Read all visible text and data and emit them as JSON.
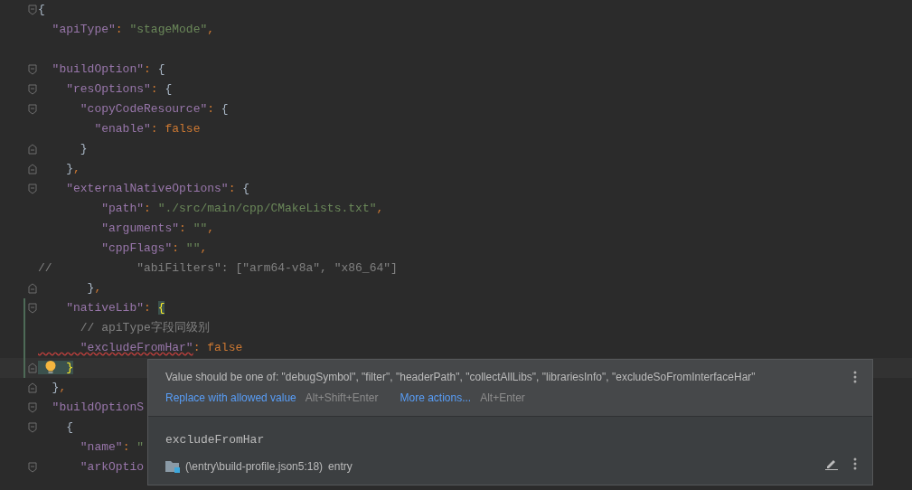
{
  "editor": {
    "lines": [
      {
        "fold_start": true,
        "tokens": [
          {
            "kind": "brace",
            "text": "{"
          }
        ]
      },
      {
        "tokens": [
          {
            "kind": "key",
            "text": "  \"apiType\""
          },
          {
            "kind": "punct",
            "text": ": "
          },
          {
            "kind": "string",
            "text": "\"stageMode\""
          },
          {
            "kind": "punct",
            "text": ","
          }
        ]
      },
      {
        "blank_line_before": true,
        "fold_start": true,
        "tokens": [
          {
            "kind": "key",
            "text": "  \"buildOption\""
          },
          {
            "kind": "punct",
            "text": ": "
          },
          {
            "kind": "brace",
            "text": "{"
          }
        ]
      },
      {
        "fold_start": true,
        "tokens": [
          {
            "kind": "key",
            "text": "    \"resOptions\""
          },
          {
            "kind": "punct",
            "text": ": "
          },
          {
            "kind": "brace",
            "text": "{"
          }
        ]
      },
      {
        "fold_start": true,
        "tokens": [
          {
            "kind": "key",
            "text": "      \"copyCodeResource\""
          },
          {
            "kind": "punct",
            "text": ": "
          },
          {
            "kind": "brace",
            "text": "{"
          }
        ]
      },
      {
        "tokens": [
          {
            "kind": "key",
            "text": "        \"enable\""
          },
          {
            "kind": "punct",
            "text": ": "
          },
          {
            "kind": "literal",
            "text": "false"
          }
        ]
      },
      {
        "fold_end": true,
        "tokens": [
          {
            "kind": "brace",
            "text": "      }"
          }
        ]
      },
      {
        "fold_end": true,
        "tokens": [
          {
            "kind": "brace",
            "text": "    }"
          },
          {
            "kind": "punct",
            "text": ","
          }
        ]
      },
      {
        "fold_start": true,
        "tokens": [
          {
            "kind": "key",
            "text": "    \"externalNativeOptions\""
          },
          {
            "kind": "punct",
            "text": ": "
          },
          {
            "kind": "brace",
            "text": "{"
          }
        ]
      },
      {
        "tokens": [
          {
            "kind": "key",
            "text": "         \"path\""
          },
          {
            "kind": "punct",
            "text": ": "
          },
          {
            "kind": "string",
            "text": "\"./src/main/cpp/CMakeLists.txt\""
          },
          {
            "kind": "punct",
            "text": ","
          }
        ]
      },
      {
        "tokens": [
          {
            "kind": "key",
            "text": "         \"arguments\""
          },
          {
            "kind": "punct",
            "text": ": "
          },
          {
            "kind": "string",
            "text": "\"\""
          },
          {
            "kind": "punct",
            "text": ","
          }
        ]
      },
      {
        "tokens": [
          {
            "kind": "key",
            "text": "         \"cppFlags\""
          },
          {
            "kind": "punct",
            "text": ": "
          },
          {
            "kind": "string",
            "text": "\"\""
          },
          {
            "kind": "punct",
            "text": ","
          }
        ]
      },
      {
        "tokens": [
          {
            "kind": "comment",
            "text": "//            \"abiFilters\": [\"arm64-v8a\", \"x86_64\"]"
          }
        ]
      },
      {
        "fold_end": true,
        "tokens": [
          {
            "kind": "brace",
            "text": "       }"
          },
          {
            "kind": "punct",
            "text": ","
          }
        ]
      },
      {
        "fold_start": true,
        "changed": true,
        "tokens": [
          {
            "kind": "key",
            "text": "    \"nativeLib\""
          },
          {
            "kind": "punct",
            "text": ": "
          },
          {
            "kind": "matched",
            "text": "{"
          }
        ]
      },
      {
        "changed": true,
        "tokens": [
          {
            "kind": "comment",
            "text": "      // apiType字段同级别"
          }
        ]
      },
      {
        "changed": true,
        "tokens": [
          {
            "kind": "error",
            "text": "      \"excludeFromHar\""
          },
          {
            "kind": "punct",
            "text": ": "
          },
          {
            "kind": "literal",
            "text": "false"
          }
        ]
      },
      {
        "fold_end": true,
        "changed": true,
        "current": true,
        "bulb": true,
        "tokens": [
          {
            "kind": "matched",
            "text": "    }"
          }
        ]
      },
      {
        "fold_end": true,
        "tokens": [
          {
            "kind": "brace",
            "text": "  }"
          },
          {
            "kind": "punct",
            "text": ","
          }
        ]
      },
      {
        "fold_start": true,
        "tokens": [
          {
            "kind": "key",
            "text": "  \"buildOptionS"
          }
        ]
      },
      {
        "fold_start": true,
        "tokens": [
          {
            "kind": "brace",
            "text": "    {"
          }
        ]
      },
      {
        "tokens": [
          {
            "kind": "key",
            "text": "      \"name\""
          },
          {
            "kind": "punct",
            "text": ": "
          },
          {
            "kind": "string",
            "text": "\""
          }
        ]
      },
      {
        "fold_start": true,
        "tokens": [
          {
            "kind": "key",
            "text": "      \"arkOptio"
          }
        ]
      }
    ]
  },
  "popup": {
    "message": "Value should be one of: \"debugSymbol\", \"filter\", \"headerPath\", \"collectAllLibs\", \"librariesInfo\", \"excludeSoFromInterfaceHar\"",
    "actions": [
      {
        "label": "Replace with allowed value",
        "shortcut": "Alt+Shift+Enter"
      },
      {
        "label": "More actions...",
        "shortcut": "Alt+Enter"
      }
    ],
    "symbol": "excludeFromHar",
    "location": "(\\entry\\build-profile.json5:18)",
    "module": "entry"
  }
}
